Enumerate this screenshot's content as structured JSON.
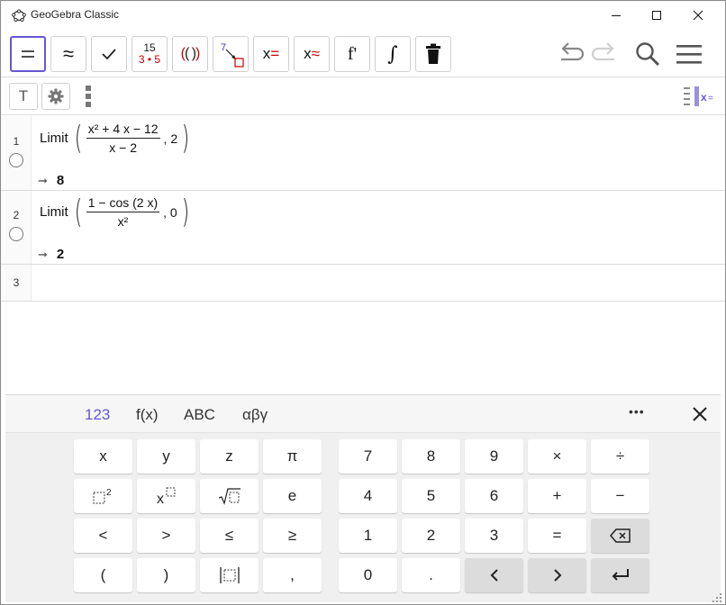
{
  "window": {
    "title": "GeoGebra Classic"
  },
  "toolbar": {
    "tools": [
      {
        "name": "evaluate-tool",
        "label": "="
      },
      {
        "name": "numeric-tool",
        "label": "≈"
      },
      {
        "name": "keep-input-tool",
        "label": "✓"
      },
      {
        "name": "factor-tool",
        "top": "15",
        "bottom": "3 • 5"
      },
      {
        "name": "expand-tool",
        "label": "(( ))"
      },
      {
        "name": "substitute-tool",
        "label": "7"
      },
      {
        "name": "solve-tool",
        "label": "x="
      },
      {
        "name": "solve-numerically-tool",
        "label": "x≈"
      },
      {
        "name": "derivative-tool",
        "label": "f'"
      },
      {
        "name": "integral-tool",
        "label": "∫"
      },
      {
        "name": "delete-tool",
        "label": ""
      }
    ]
  },
  "av_header": {
    "input_label": "T"
  },
  "rows": [
    {
      "num": "1",
      "fn": "Limit",
      "numerator": "x² + 4 x − 12",
      "denominator": "x − 2",
      "arg": ", 2",
      "result": "8"
    },
    {
      "num": "2",
      "fn": "Limit",
      "numerator": "1 − cos (2 x)",
      "denominator": "x²",
      "arg": ", 0",
      "result": "2"
    },
    {
      "num": "3"
    }
  ],
  "keyboard": {
    "tabs": [
      "123",
      "f(x)",
      "ABC",
      "αβγ"
    ],
    "more_label": "•••",
    "keys_left": [
      [
        "x",
        "y",
        "z",
        "π"
      ],
      [
        "□²",
        "x□",
        "√□",
        "e"
      ],
      [
        "<",
        ">",
        "≤",
        "≥"
      ],
      [
        "(",
        ")",
        "|□|",
        ","
      ]
    ],
    "keys_right": [
      [
        "7",
        "8",
        "9",
        "×",
        "÷"
      ],
      [
        "4",
        "5",
        "6",
        "+",
        "−"
      ],
      [
        "1",
        "2",
        "3",
        "=",
        "⌫"
      ],
      [
        "0",
        ".",
        "‹",
        "›",
        "↵"
      ]
    ]
  },
  "colors": {
    "accent": "#6557d2",
    "factor_red": "#cc0000"
  }
}
